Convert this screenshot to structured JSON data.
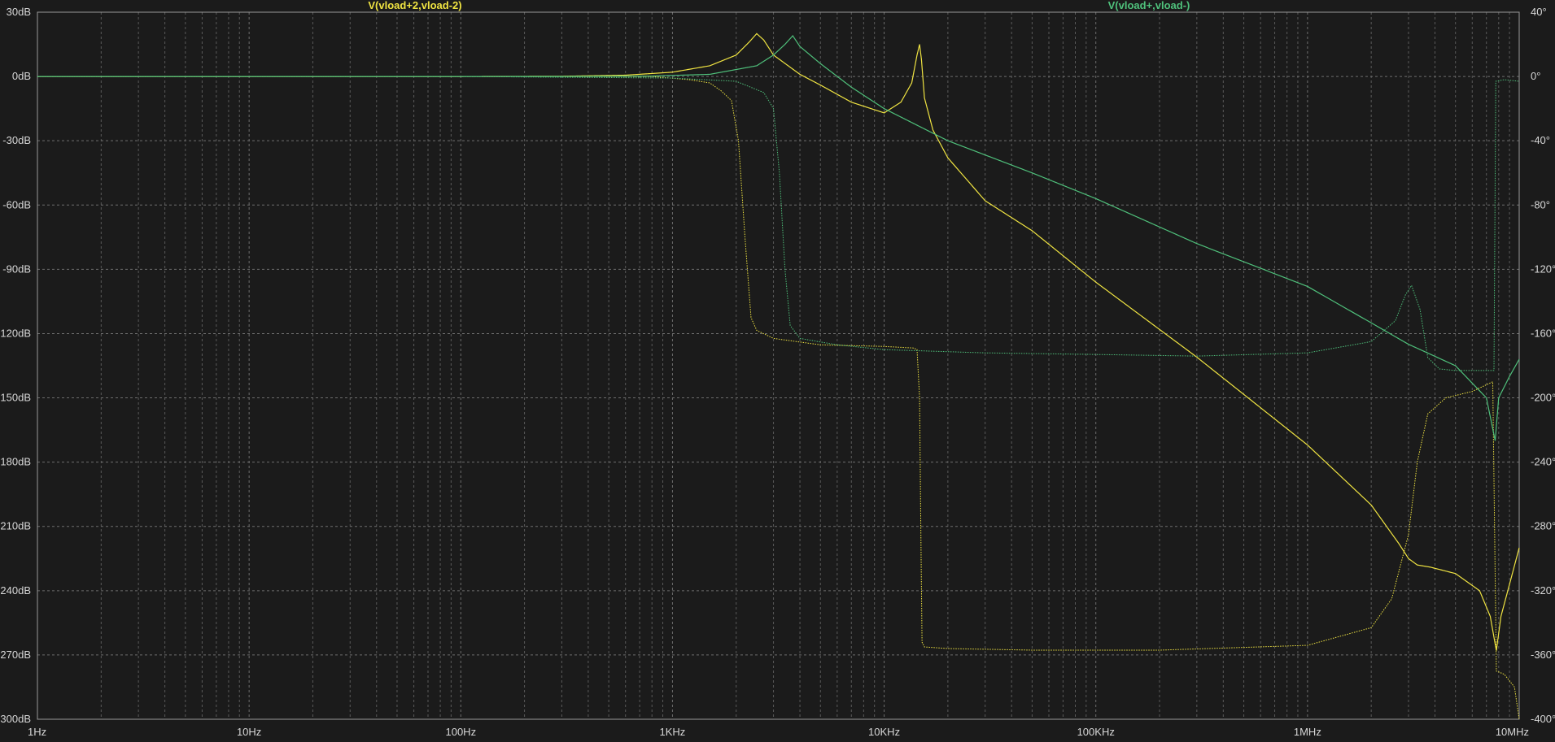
{
  "chart_data": {
    "type": "line",
    "x_scale": "log",
    "xlim": [
      1,
      10000000
    ],
    "x_ticks": [
      {
        "value": 1,
        "label": "1Hz"
      },
      {
        "value": 10,
        "label": "10Hz"
      },
      {
        "value": 100,
        "label": "100Hz"
      },
      {
        "value": 1000,
        "label": "1KHz"
      },
      {
        "value": 10000,
        "label": "10KHz"
      },
      {
        "value": 100000,
        "label": "100KHz"
      },
      {
        "value": 1000000,
        "label": "1MHz"
      },
      {
        "value": 10000000,
        "label": "10MHz"
      }
    ],
    "y_left": {
      "ylim": [
        -300,
        30
      ],
      "ticks": [
        {
          "value": 30,
          "label": "30dB"
        },
        {
          "value": 0,
          "label": "0dB"
        },
        {
          "value": -30,
          "label": "-30dB"
        },
        {
          "value": -60,
          "label": "-60dB"
        },
        {
          "value": -90,
          "label": "-90dB"
        },
        {
          "value": -120,
          "label": "-120dB"
        },
        {
          "value": -150,
          "label": "-150dB"
        },
        {
          "value": -180,
          "label": "-180dB"
        },
        {
          "value": -210,
          "label": "-210dB"
        },
        {
          "value": -240,
          "label": "-240dB"
        },
        {
          "value": -270,
          "label": "-270dB"
        },
        {
          "value": -300,
          "label": "-300dB"
        }
      ]
    },
    "y_right": {
      "ylim": [
        -400,
        40
      ],
      "ticks": [
        {
          "value": 40,
          "label": "40°"
        },
        {
          "value": 0,
          "label": "0°"
        },
        {
          "value": -40,
          "label": "-40°"
        },
        {
          "value": -80,
          "label": "-80°"
        },
        {
          "value": -120,
          "label": "-120°"
        },
        {
          "value": -160,
          "label": "-160°"
        },
        {
          "value": -200,
          "label": "-200°"
        },
        {
          "value": -240,
          "label": "-240°"
        },
        {
          "value": -280,
          "label": "-280°"
        },
        {
          "value": -320,
          "label": "-320°"
        },
        {
          "value": -360,
          "label": "-360°"
        },
        {
          "value": -400,
          "label": "-400°"
        }
      ]
    },
    "grid": true,
    "series": [
      {
        "name": "V(vload+2,vload-2)",
        "color": "#f0e442",
        "magnitude_db": [
          [
            1,
            0
          ],
          [
            100,
            0
          ],
          [
            300,
            0.1
          ],
          [
            600,
            0.6
          ],
          [
            1000,
            2
          ],
          [
            1500,
            5
          ],
          [
            2000,
            10
          ],
          [
            2300,
            16
          ],
          [
            2500,
            20
          ],
          [
            2700,
            17
          ],
          [
            3000,
            10
          ],
          [
            4000,
            1
          ],
          [
            5000,
            -4
          ],
          [
            7000,
            -12
          ],
          [
            10000,
            -17
          ],
          [
            12000,
            -12
          ],
          [
            13500,
            -3
          ],
          [
            14300,
            10
          ],
          [
            14700,
            15
          ],
          [
            15000,
            8
          ],
          [
            15500,
            -10
          ],
          [
            17000,
            -25
          ],
          [
            20000,
            -38
          ],
          [
            30000,
            -58
          ],
          [
            50000,
            -72
          ],
          [
            100000,
            -96
          ],
          [
            300000,
            -131
          ],
          [
            1000000,
            -172
          ],
          [
            2000000,
            -200
          ],
          [
            2700000,
            -218
          ],
          [
            3000000,
            -225
          ],
          [
            3300000,
            -228
          ],
          [
            3800000,
            -229
          ],
          [
            5000000,
            -232
          ],
          [
            6500000,
            -240
          ],
          [
            7300000,
            -252
          ],
          [
            7800000,
            -268
          ],
          [
            8200000,
            -252
          ],
          [
            9000000,
            -237
          ],
          [
            10000000,
            -220
          ]
        ],
        "phase_deg": [
          [
            1,
            0
          ],
          [
            100,
            0
          ],
          [
            800,
            0
          ],
          [
            1200,
            -2
          ],
          [
            1500,
            -4
          ],
          [
            1700,
            -9
          ],
          [
            1900,
            -15
          ],
          [
            2050,
            -40
          ],
          [
            2200,
            -100
          ],
          [
            2350,
            -150
          ],
          [
            2500,
            -158
          ],
          [
            3000,
            -163
          ],
          [
            5000,
            -167
          ],
          [
            10000,
            -168
          ],
          [
            13800,
            -169
          ],
          [
            14300,
            -170
          ],
          [
            14700,
            -200
          ],
          [
            14950,
            -300
          ],
          [
            15100,
            -352
          ],
          [
            15500,
            -355
          ],
          [
            20000,
            -356
          ],
          [
            50000,
            -357
          ],
          [
            200000,
            -357
          ],
          [
            1000000,
            -354
          ],
          [
            2000000,
            -343
          ],
          [
            2500000,
            -325
          ],
          [
            3000000,
            -285
          ],
          [
            3300000,
            -240
          ],
          [
            3700000,
            -210
          ],
          [
            4500000,
            -200
          ],
          [
            6000000,
            -196
          ],
          [
            7500000,
            -190
          ],
          [
            7800000,
            -370
          ],
          [
            8500000,
            -372
          ],
          [
            9500000,
            -380
          ],
          [
            10000000,
            -400
          ]
        ]
      },
      {
        "name": "V(vload+,vload-)",
        "color": "#4fc07b",
        "magnitude_db": [
          [
            1,
            0
          ],
          [
            300,
            0
          ],
          [
            800,
            0.2
          ],
          [
            1500,
            1
          ],
          [
            2500,
            5
          ],
          [
            3000,
            10
          ],
          [
            3400,
            15
          ],
          [
            3700,
            19
          ],
          [
            4000,
            14
          ],
          [
            5000,
            6
          ],
          [
            7000,
            -5
          ],
          [
            10000,
            -15
          ],
          [
            20000,
            -30
          ],
          [
            50000,
            -45
          ],
          [
            100000,
            -57
          ],
          [
            300000,
            -78
          ],
          [
            1000000,
            -98
          ],
          [
            2000000,
            -115
          ],
          [
            3000000,
            -125
          ],
          [
            3500000,
            -128
          ],
          [
            5000000,
            -135
          ],
          [
            7000000,
            -150
          ],
          [
            7700000,
            -170
          ],
          [
            8000000,
            -150
          ],
          [
            9000000,
            -140
          ],
          [
            10000000,
            -132
          ]
        ],
        "phase_deg": [
          [
            1,
            0
          ],
          [
            100,
            0
          ],
          [
            1000,
            -1
          ],
          [
            2000,
            -3
          ],
          [
            2700,
            -10
          ],
          [
            3000,
            -20
          ],
          [
            3200,
            -60
          ],
          [
            3400,
            -120
          ],
          [
            3600,
            -155
          ],
          [
            4000,
            -163
          ],
          [
            6000,
            -167
          ],
          [
            10000,
            -170
          ],
          [
            30000,
            -172
          ],
          [
            100000,
            -173
          ],
          [
            300000,
            -174
          ],
          [
            1000000,
            -172
          ],
          [
            2000000,
            -165
          ],
          [
            2600000,
            -152
          ],
          [
            2900000,
            -136
          ],
          [
            3100000,
            -130
          ],
          [
            3400000,
            -145
          ],
          [
            3700000,
            -175
          ],
          [
            4200000,
            -182
          ],
          [
            5000000,
            -183
          ],
          [
            6000000,
            -183
          ],
          [
            7600000,
            -183
          ],
          [
            7750000,
            -3
          ],
          [
            8500000,
            -2
          ],
          [
            10000000,
            -3
          ]
        ]
      }
    ]
  }
}
